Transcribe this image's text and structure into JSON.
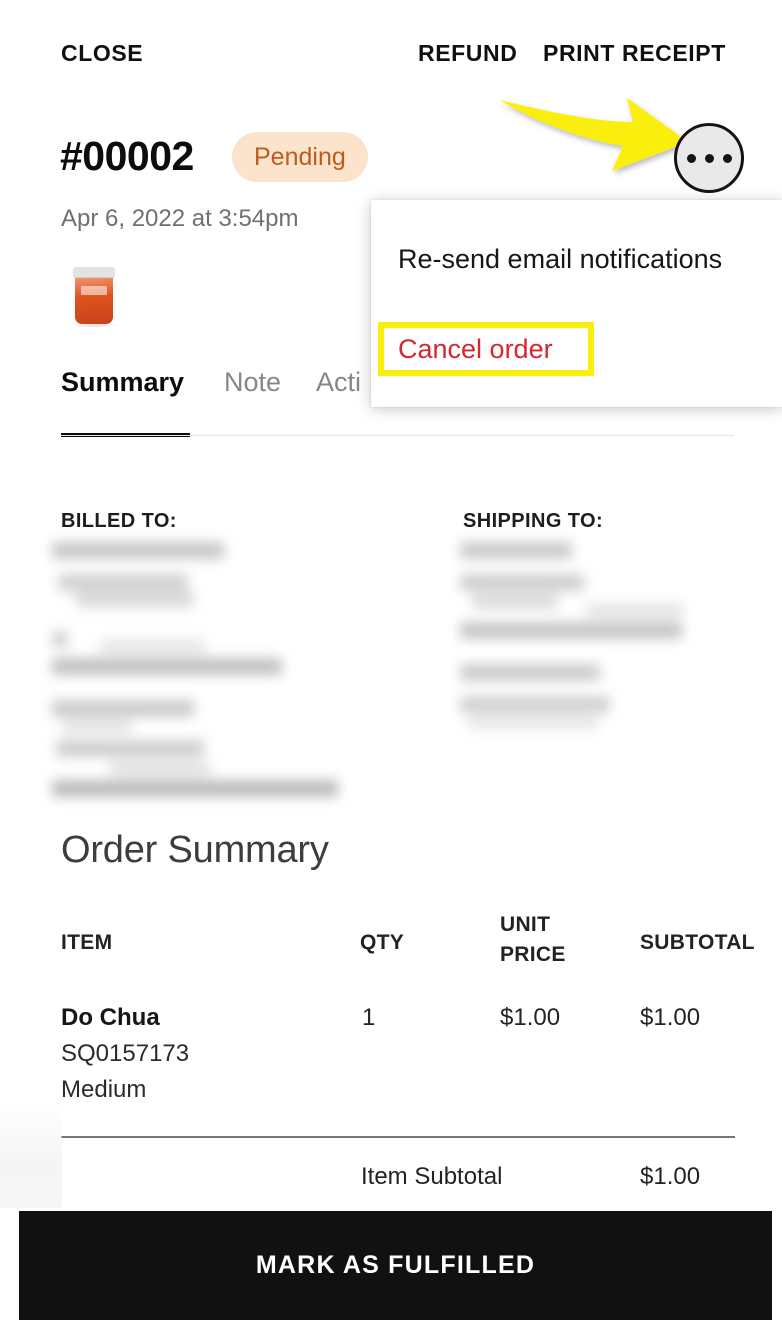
{
  "app": {
    "screen_name": "order-detail"
  },
  "topbar": {
    "close_label": "CLOSE",
    "refund_label": "REFUND",
    "print_receipt_label": "PRINT RECEIPT"
  },
  "order": {
    "number": "#00002",
    "status": "Pending",
    "status_bg": "#fbe4cb",
    "status_fg": "#bf5a1e",
    "date": "Apr 6, 2022 at 3:54pm",
    "thumbnail_alt": "product-jar-thumbnail"
  },
  "tabs": [
    {
      "label": "Summary",
      "active": true
    },
    {
      "label": "Note",
      "active": false
    },
    {
      "label": "Acti",
      "active": false
    }
  ],
  "addresses": {
    "billed_label": "BILLED TO:",
    "shipping_label": "SHIPPING TO:",
    "billed_value": "",
    "shipping_value": ""
  },
  "summary": {
    "title": "Order Summary",
    "columns": {
      "item": "ITEM",
      "qty": "QTY",
      "unit_price_line1": "UNIT",
      "unit_price_line2": "PRICE",
      "subtotal": "SUBTOTAL"
    },
    "rows": [
      {
        "item": "Do Chua",
        "sku": "SQ0157173",
        "variant": "Medium",
        "qty": "1",
        "unit_price": "$1.00",
        "subtotal": "$1.00"
      }
    ],
    "totals": [
      {
        "label": "Item Subtotal",
        "value": "$1.00"
      }
    ]
  },
  "menu": {
    "items": [
      {
        "label": "Re-send email notifications",
        "destructive": false
      },
      {
        "label": "Cancel order",
        "destructive": true
      }
    ]
  },
  "annotation": {
    "arrow_color": "#faee0a",
    "highlight_color": "#faee0a",
    "points_to": "overflow-menu-button"
  },
  "footer": {
    "primary_action": "MARK AS FULFILLED",
    "primary_bg": "#111111"
  }
}
